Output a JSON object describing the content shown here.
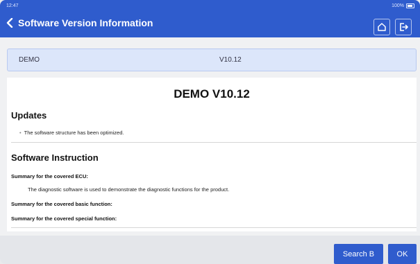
{
  "status_bar": {
    "time": "12:47",
    "battery": "100%"
  },
  "header": {
    "title": "Software Version Information"
  },
  "software_row": {
    "name": "DEMO",
    "version": "V10.12"
  },
  "document": {
    "title": "DEMO V10.12",
    "updates_heading": "Updates",
    "updates_items": [
      "The software structure has been optimized."
    ],
    "instruction_heading": "Software Instruction",
    "summary_ecu_label": "Summary for the covered ECU:",
    "summary_ecu_text": "The diagnostic software is used to demonstrate the diagnostic functions for the product.",
    "summary_basic_label": "Summary for the covered basic function:",
    "summary_special_label": "Summary for the covered special function:"
  },
  "buttons": {
    "search": "Search B",
    "ok": "OK"
  },
  "colors": {
    "accent": "#2f5ccd",
    "row_bg": "#dce6fa"
  },
  "icons": {
    "back": "chevron-left-icon",
    "home": "home-icon",
    "exit": "exit-icon"
  }
}
